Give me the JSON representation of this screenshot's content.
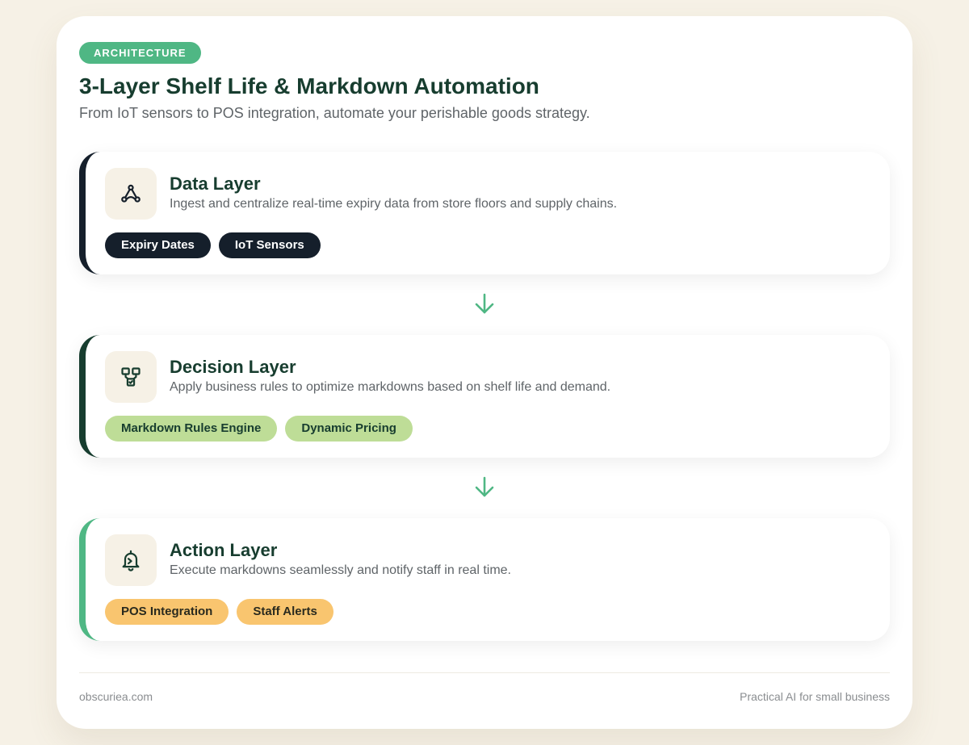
{
  "header": {
    "badge": "ARCHITECTURE",
    "title": "3-Layer Shelf Life & Markdown Automation",
    "subtitle": "From IoT sensors to POS integration, automate your perishable goods strategy."
  },
  "layers": [
    {
      "icon": "nodes-icon",
      "title": "Data Layer",
      "description": "Ingest and centralize real-time expiry data from store floors and supply chains.",
      "tags": [
        "Expiry Dates",
        "IoT Sensors"
      ]
    },
    {
      "icon": "rules-icon",
      "title": "Decision Layer",
      "description": "Apply business rules to optimize markdowns based on shelf life and demand.",
      "tags": [
        "Markdown Rules Engine",
        "Dynamic Pricing"
      ]
    },
    {
      "icon": "bell-icon",
      "title": "Action Layer",
      "description": "Execute markdowns seamlessly and notify staff in real time.",
      "tags": [
        "POS Integration",
        "Staff Alerts"
      ]
    }
  ],
  "footer": {
    "left": "obscuriea.com",
    "right": "Practical AI for small business"
  },
  "colors": {
    "background": "#f6f1e6",
    "accent_green": "#4fb784",
    "dark_navy": "#151f2b",
    "dark_green": "#173d2f",
    "tag_green": "#bedd97",
    "tag_orange": "#f9c56f"
  }
}
